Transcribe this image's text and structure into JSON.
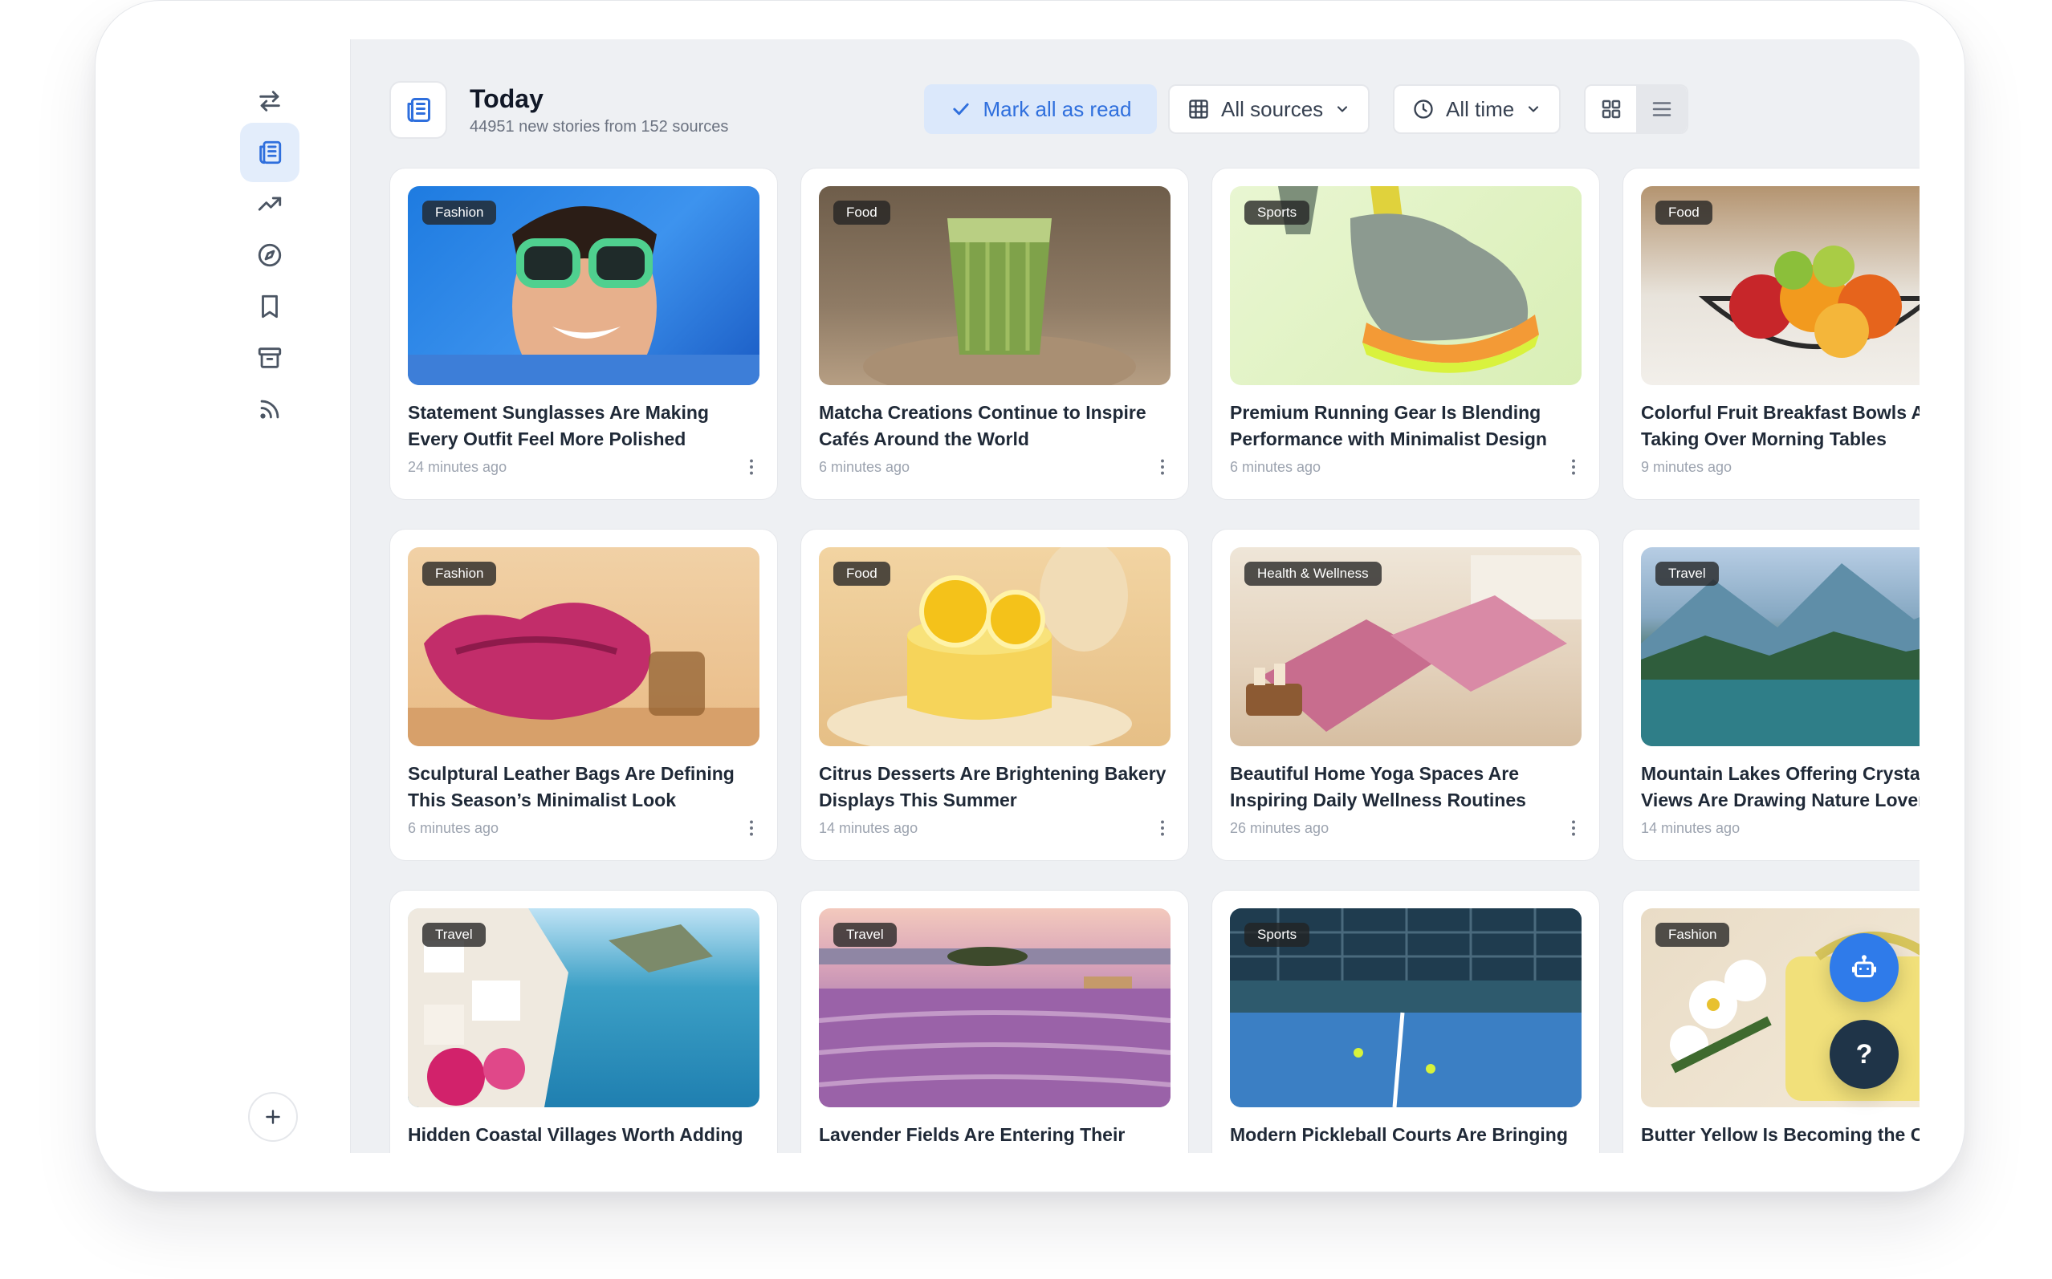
{
  "header": {
    "title": "Today",
    "subtitle": "44951 new stories from 152 sources",
    "mark_all_read": "Mark all as read",
    "sources_filter": "All sources",
    "time_filter": "All time"
  },
  "sidebar": {
    "items": [
      {
        "icon": "swap-arrows-icon"
      },
      {
        "icon": "newspaper-icon",
        "active": true
      },
      {
        "icon": "trending-icon"
      },
      {
        "icon": "compass-icon"
      },
      {
        "icon": "bookmark-icon"
      },
      {
        "icon": "archive-icon"
      },
      {
        "icon": "rss-icon"
      }
    ],
    "add_icon": "plus-icon"
  },
  "colors": {
    "accent": "#2f6fdd",
    "accent_soft": "#dbe8fb",
    "help_fab": "#1f3448",
    "bot_fab": "#2f7bea"
  },
  "cards": [
    {
      "category": "Fashion",
      "title": "Statement Sunglasses Are Making Every Outfit Feel More Polished",
      "time": "24 minutes ago"
    },
    {
      "category": "Food",
      "title": "Matcha Creations Continue to Inspire Cafés Around the World",
      "time": "6 minutes ago"
    },
    {
      "category": "Sports",
      "title": "Premium Running Gear Is Blending Performance with Minimalist Design",
      "time": "6 minutes ago"
    },
    {
      "category": "Food",
      "title": "Colorful Fruit Breakfast Bowls Are Taking Over Morning Tables",
      "time": "9 minutes ago"
    },
    {
      "category": "Fashion",
      "title": "Sculptural Leather Bags Are Defining This Season’s Minimalist Look",
      "time": "6 minutes ago"
    },
    {
      "category": "Food",
      "title": "Citrus Desserts Are Brightening Bakery Displays This Summer",
      "time": "14 minutes ago"
    },
    {
      "category": "Health & Wellness",
      "title": "Beautiful Home Yoga Spaces Are Inspiring Daily Wellness Routines",
      "time": "26 minutes ago"
    },
    {
      "category": "Travel",
      "title": "Mountain Lakes Offering Crystal-Clear Views Are Drawing Nature Lovers",
      "time": "14 minutes ago"
    },
    {
      "category": "Travel",
      "title": "Hidden Coastal Villages Worth Adding to",
      "time": ""
    },
    {
      "category": "Travel",
      "title": "Lavender Fields Are Entering Their Most",
      "time": ""
    },
    {
      "category": "Sports",
      "title": "Modern Pickleball Courts Are Bringing",
      "time": ""
    },
    {
      "category": "Fashion",
      "title": "Butter Yellow Is Becoming the Color",
      "time": ""
    }
  ],
  "fab": {
    "help_label": "?"
  }
}
